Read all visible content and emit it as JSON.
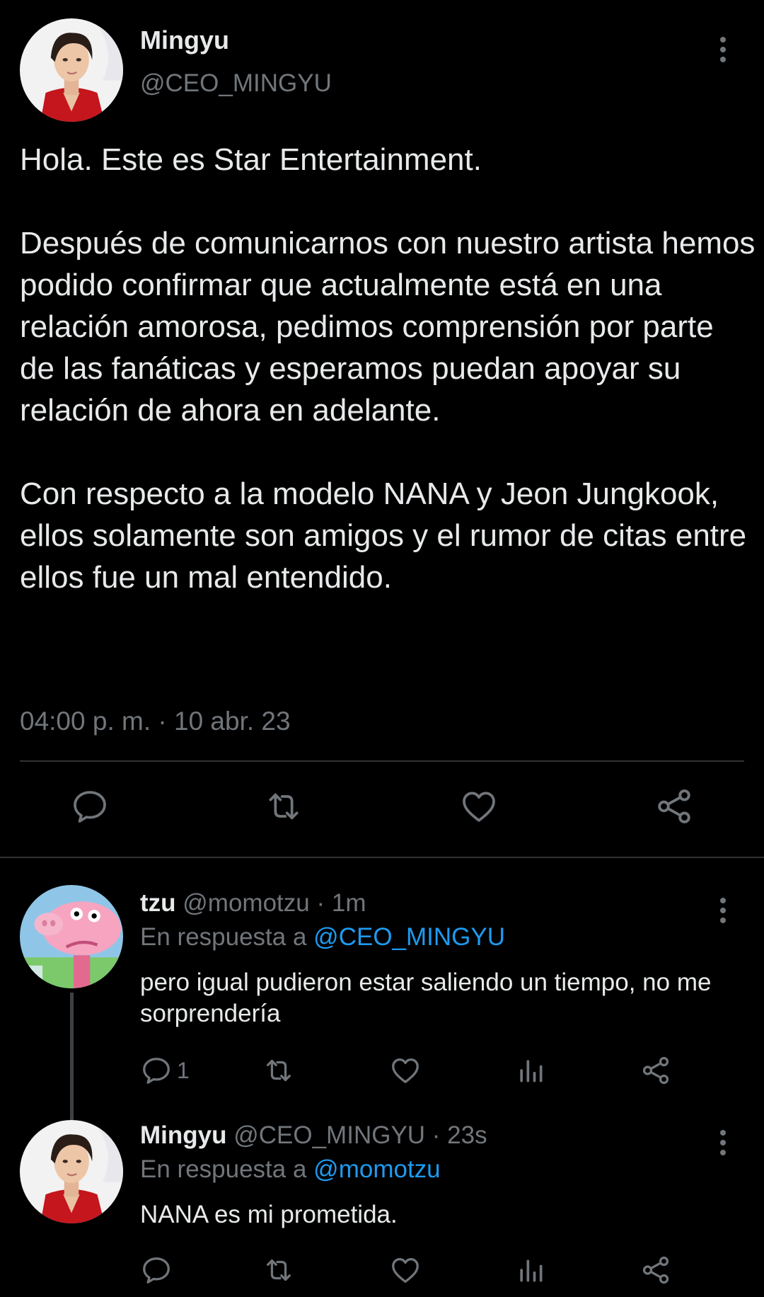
{
  "main_tweet": {
    "author_name": "Mingyu",
    "author_handle": "@CEO_MINGYU",
    "text": "Hola. Este es Star Entertainment.\n\nDespués de comunicarnos con nuestro artista hemos podido confirmar que actualmente está en una relación amorosa, pedimos comprensión por parte de las fanáticas y esperamos puedan apoyar su relación de ahora en adelante.\n\nCon respecto a la modelo NANA y Jeon Jungkook, ellos solamente son amigos y el rumor de citas entre ellos fue un mal entendido.",
    "timestamp": "04:00 p. m. · 10 abr. 23",
    "actions": [
      "reply-icon",
      "retweet-icon",
      "like-icon",
      "share-icon"
    ]
  },
  "replies": [
    {
      "author_name": "tzu",
      "author_handle": "@momotzu",
      "time": "· 1m",
      "reply_prefix": "En respuesta a",
      "reply_to": "@CEO_MINGYU",
      "text": "pero igual pudieron estar saliendo un tiempo, no me sorprendería",
      "reply_count": "1"
    },
    {
      "author_name": "Mingyu",
      "author_handle": "@CEO_MINGYU",
      "time": "· 23s",
      "reply_prefix": "En respuesta a",
      "reply_to": "@momotzu",
      "text": "NANA es mi prometida.",
      "reply_count": ""
    }
  ],
  "colors": {
    "background": "#000000",
    "text": "#e7e9ea",
    "muted": "#71767b",
    "link": "#1d9bf0",
    "divider": "#2f3336"
  }
}
